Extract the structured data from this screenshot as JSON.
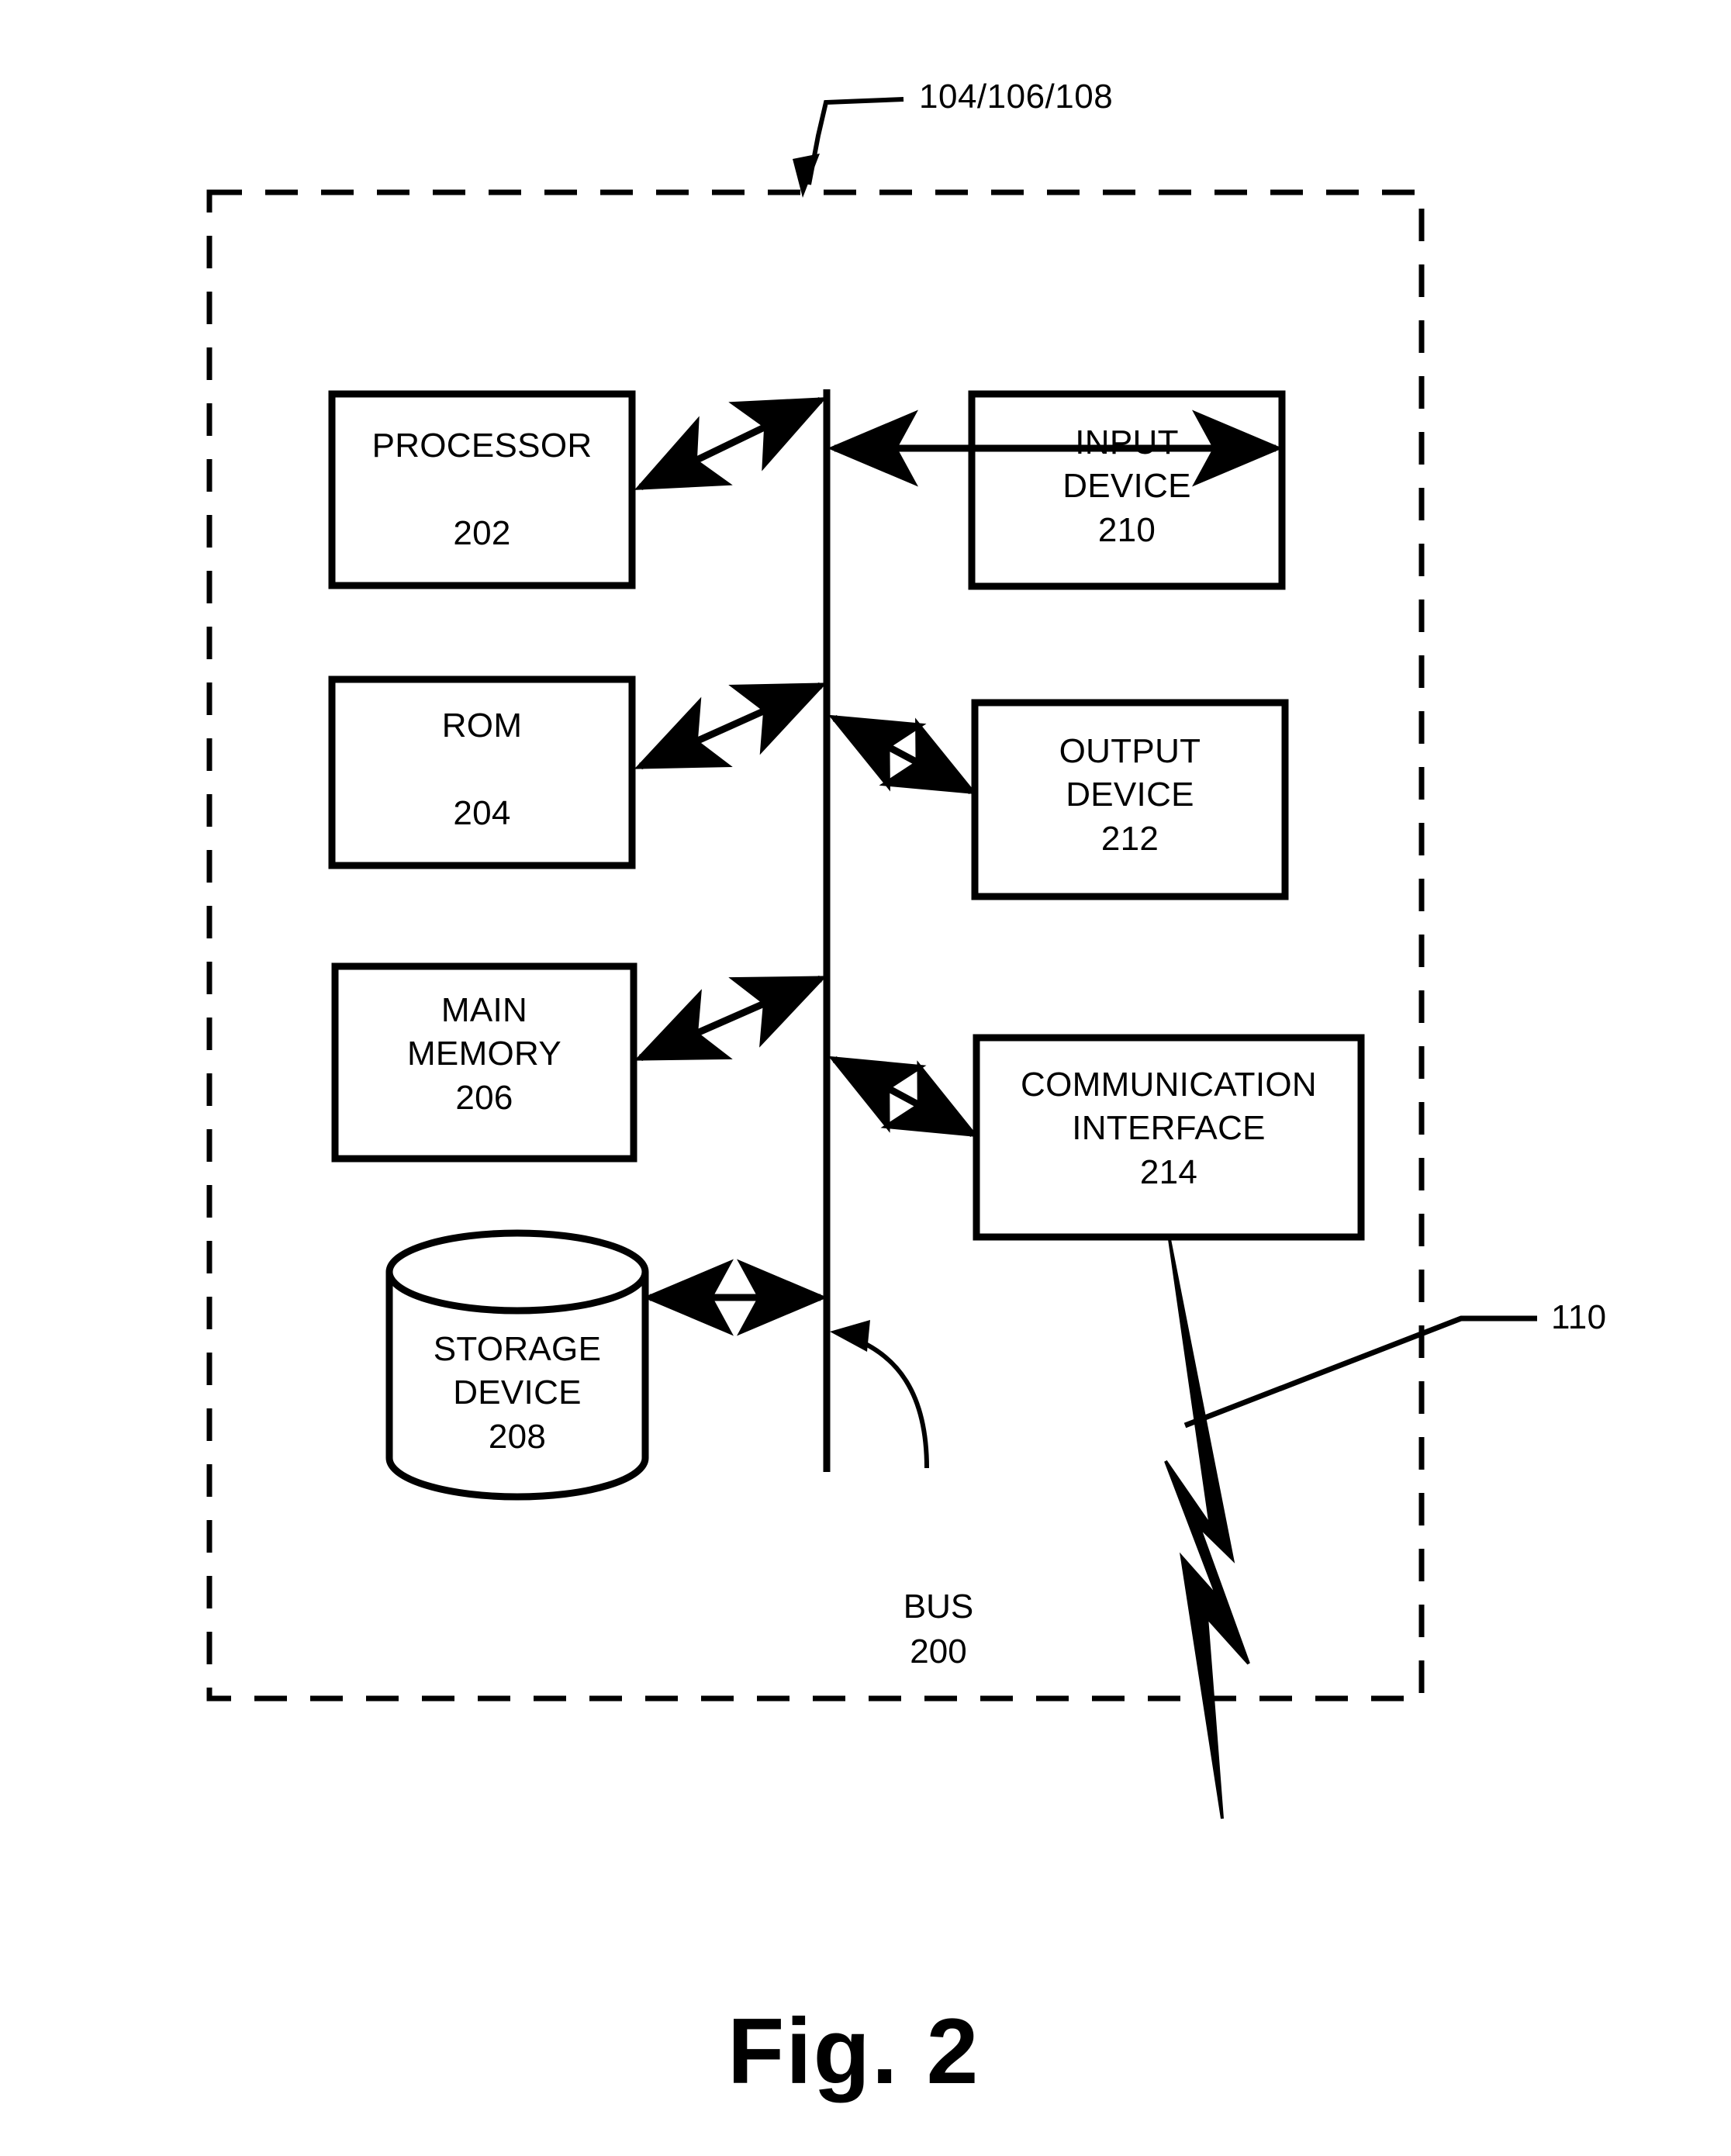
{
  "figure": {
    "caption": "Fig. 2",
    "system_reference": "104/106/108",
    "network_reference": "110"
  },
  "bus": {
    "name": "BUS",
    "number": "200",
    "label": "BUS\n200"
  },
  "nodes": [
    {
      "id": "processor",
      "name": "PROCESSOR",
      "number": "202",
      "label": "PROCESSOR\n\n202",
      "shape": "rect",
      "side": "left"
    },
    {
      "id": "rom",
      "name": "ROM",
      "number": "204",
      "label": "ROM\n\n204",
      "shape": "rect",
      "side": "left"
    },
    {
      "id": "main-memory",
      "name": "MAIN MEMORY",
      "number": "206",
      "label": "MAIN\nMEMORY\n206",
      "shape": "rect",
      "side": "left"
    },
    {
      "id": "storage-device",
      "name": "STORAGE DEVICE",
      "number": "208",
      "label": "STORAGE\nDEVICE\n208",
      "shape": "cylinder",
      "side": "left"
    },
    {
      "id": "input-device",
      "name": "INPUT DEVICE",
      "number": "210",
      "label": "INPUT\nDEVICE\n210",
      "shape": "rect",
      "side": "right"
    },
    {
      "id": "output-device",
      "name": "OUTPUT DEVICE",
      "number": "212",
      "label": "OUTPUT\nDEVICE\n212",
      "shape": "rect",
      "side": "right"
    },
    {
      "id": "communication-interface",
      "name": "COMMUNICATION INTERFACE",
      "number": "214",
      "label": "COMMUNICATION\nINTERFACE\n214",
      "shape": "rect",
      "side": "right"
    }
  ],
  "colors": {
    "ink": "#000000",
    "paper": "#ffffff"
  }
}
